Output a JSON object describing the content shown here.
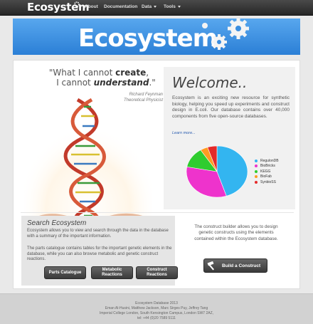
{
  "nav": {
    "brand": "Ecosystem",
    "items": [
      {
        "label": "About"
      },
      {
        "label": "Documentation"
      },
      {
        "label": "Data"
      },
      {
        "label": "Tools"
      }
    ]
  },
  "banner": {
    "title": "Ecosystem"
  },
  "quote": {
    "line1_prefix": "\"What I cannot ",
    "line1_bold": "create",
    "line1_suffix": ",",
    "line2_prefix": "I cannot ",
    "line2_bold": "understand",
    "line2_suffix": ".\"",
    "author": "Richard Feynman",
    "author_title": "Theoretical Physicist"
  },
  "welcome": {
    "title": "Welcome..",
    "text": "Ecosystem is an exciting new resource for synthetic biology, helping you speed up experiments and construct design in E.coli. Our database contains over 40,000 components from five open-source databases.",
    "learn_more": "Learn more..."
  },
  "chart_data": {
    "type": "pie",
    "series": [
      {
        "name": "RegulonDB",
        "value": 45,
        "color": "#33b5f0"
      },
      {
        "name": "BioBricks",
        "value": 33,
        "color": "#ee33cc"
      },
      {
        "name": "KEGG",
        "value": 13,
        "color": "#2fcc2f"
      },
      {
        "name": "BioFab",
        "value": 4,
        "color": "#ff9b22"
      },
      {
        "name": "SynbioSS",
        "value": 5,
        "color": "#e42a2a"
      }
    ]
  },
  "search": {
    "title": "Search Ecosystem",
    "text1": "Ecosystem allows you to view and search through the data in the database with a summary of the important information.",
    "text2": "The parts catalogue contains tables for the important genetic elements in the database, while you can also browse metabolic and genetic construct reactions.",
    "buttons": [
      {
        "label": "Parts Catalogue"
      },
      {
        "label": "Metabolic Reactions"
      },
      {
        "label": "Construct Reactions"
      }
    ]
  },
  "construct": {
    "text": "The construct builder allows you to design genetic constructs using the elements contained within the Ecosystem database.",
    "button": "Build a Construct"
  },
  "footer": {
    "lines": [
      "Ecosystem Database 2013",
      "Eman Al-Husini, Matthew Jackson, Marc Sirges Puy, Jeffrey Tang",
      "Imperial College London, South Kensington Campus, London SW7 2AZ,",
      "tel: +44 (0)20 7589 5111"
    ]
  }
}
